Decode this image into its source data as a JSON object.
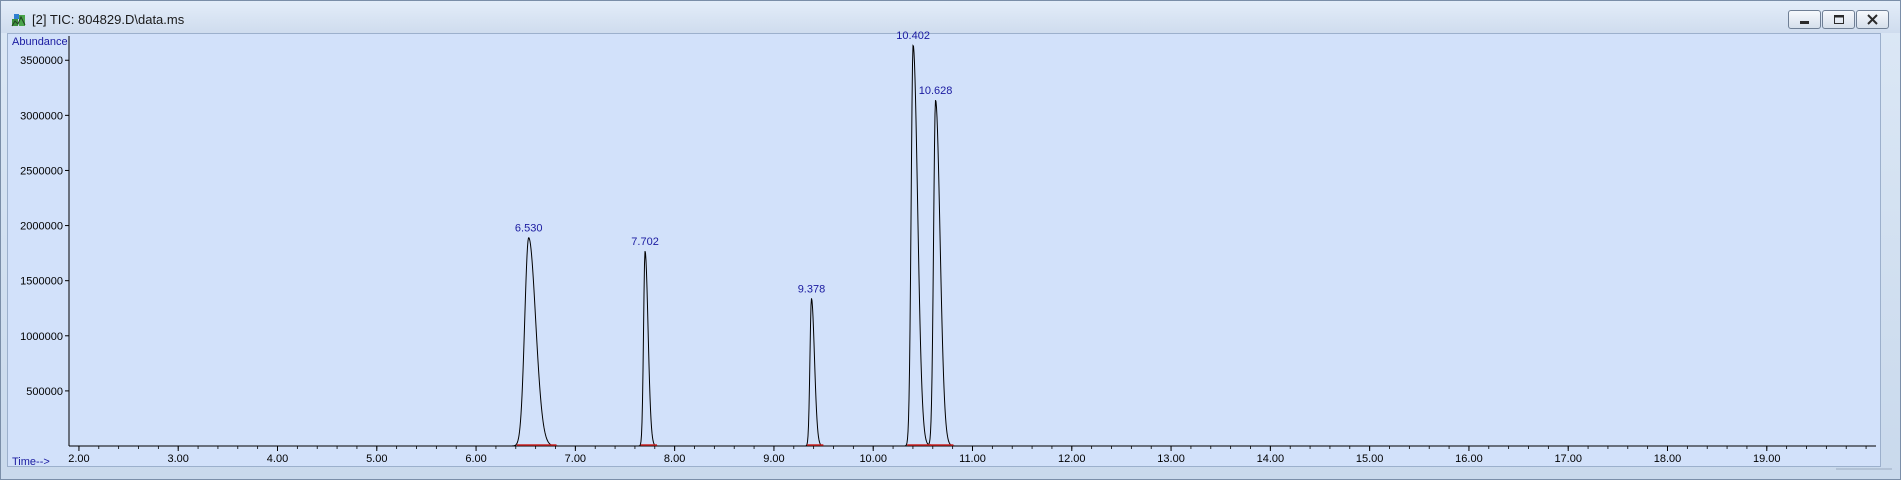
{
  "window": {
    "title": "[2] TIC: 804829.D\\data.ms"
  },
  "icons": {
    "app": "chromatogram-app-icon",
    "minimize": "minimize-icon",
    "maximize": "maximize-icon",
    "close": "close-icon"
  },
  "colors": {
    "plot_background": "#d2e1fa",
    "trace": "#000000",
    "peak_label": "#1a1aa0",
    "baseline_marks": "#cc2222",
    "axis_label": "#1a1aa0"
  },
  "chart_data": {
    "type": "line",
    "ylabel": "Abundance",
    "xlabel": "Time-->",
    "xlim": [
      1.9,
      20.1
    ],
    "ylim": [
      0,
      3720000
    ],
    "x_ticks": [
      2,
      3,
      4,
      5,
      6,
      7,
      8,
      9,
      10,
      11,
      12,
      13,
      14,
      15,
      16,
      17,
      18,
      19
    ],
    "x_tick_labels": [
      "2.00",
      "3.00",
      "4.00",
      "5.00",
      "6.00",
      "7.00",
      "8.00",
      "9.00",
      "10.00",
      "11.00",
      "12.00",
      "13.00",
      "14.00",
      "15.00",
      "16.00",
      "17.00",
      "18.00",
      "19.00"
    ],
    "y_ticks": [
      500000,
      1000000,
      1500000,
      2000000,
      2500000,
      3000000,
      3500000
    ],
    "y_tick_labels": [
      "500000",
      "1000000",
      "1500000",
      "2000000",
      "2500000",
      "3000000",
      "3500000"
    ],
    "grid": false,
    "baseline": 0,
    "peaks": [
      {
        "rt": 6.53,
        "label": "6.530",
        "height": 1890000,
        "width_left": 0.04,
        "width_right": 0.07
      },
      {
        "rt": 7.702,
        "label": "7.702",
        "height": 1770000,
        "width_left": 0.015,
        "width_right": 0.03
      },
      {
        "rt": 9.378,
        "label": "9.378",
        "height": 1340000,
        "width_left": 0.015,
        "width_right": 0.03
      },
      {
        "rt": 10.402,
        "label": "10.402",
        "height": 3640000,
        "width_left": 0.02,
        "width_right": 0.045
      },
      {
        "rt": 10.628,
        "label": "10.628",
        "height": 3140000,
        "width_left": 0.02,
        "width_right": 0.045
      }
    ]
  }
}
